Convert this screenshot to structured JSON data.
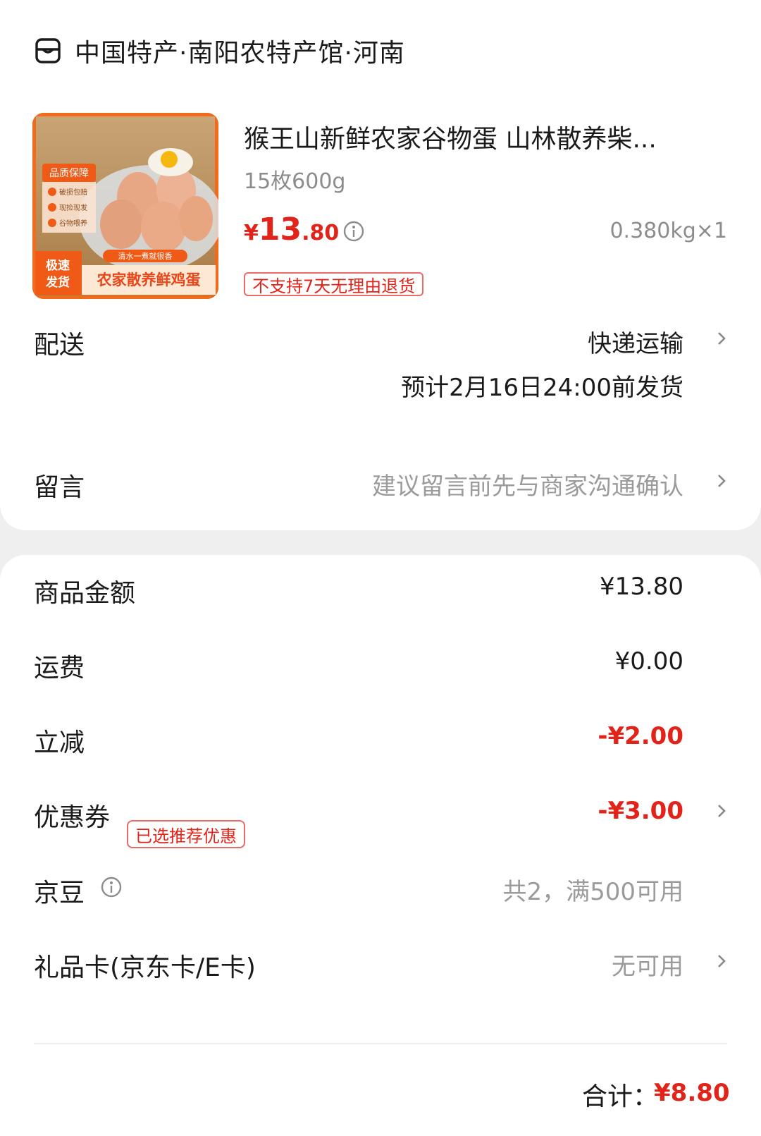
{
  "store": {
    "name": "中国特产·南阳农特产馆·河南",
    "icon": "store-icon"
  },
  "product": {
    "title": "猴王山新鲜农家谷物蛋 山林散养柴...",
    "spec": "15枚600g",
    "price_symbol": "¥",
    "price_int": "13",
    "price_dec": ".80",
    "weight_qty": "0.380kg×1",
    "no_return_tag": "不支持7天无理由退货",
    "image": {
      "quality_badge": "品质保障",
      "features": [
        "破损包赔",
        "现捡现发",
        "谷物喂养"
      ],
      "water_text": "清水一煮就很香",
      "speed_badge_line1": "极速",
      "speed_badge_line2": "发货",
      "banner": "农家散养鲜鸡蛋"
    }
  },
  "delivery": {
    "label": "配送",
    "method": "快递运输",
    "estimate": "预计2月16日24:00前发货"
  },
  "message": {
    "label": "留言",
    "placeholder": "建议留言前先与商家沟通确认"
  },
  "summary": {
    "goods_amount_label": "商品金额",
    "goods_amount": "¥13.80",
    "shipping_label": "运费",
    "shipping": "¥0.00",
    "discount_label": "立减",
    "discount": "-¥2.00",
    "coupon_label": "优惠券",
    "coupon_badge": "已选推荐优惠",
    "coupon": "-¥3.00",
    "jingdou_label": "京豆",
    "jingdou": "共2，满500可用",
    "giftcard_label": "礼品卡(京东卡/E卡)",
    "giftcard": "无可用"
  },
  "total": {
    "label": "合计：",
    "value": "¥8.80"
  },
  "colors": {
    "accent": "#e2231a",
    "muted": "#9b9b9b",
    "background": "#efefef"
  }
}
